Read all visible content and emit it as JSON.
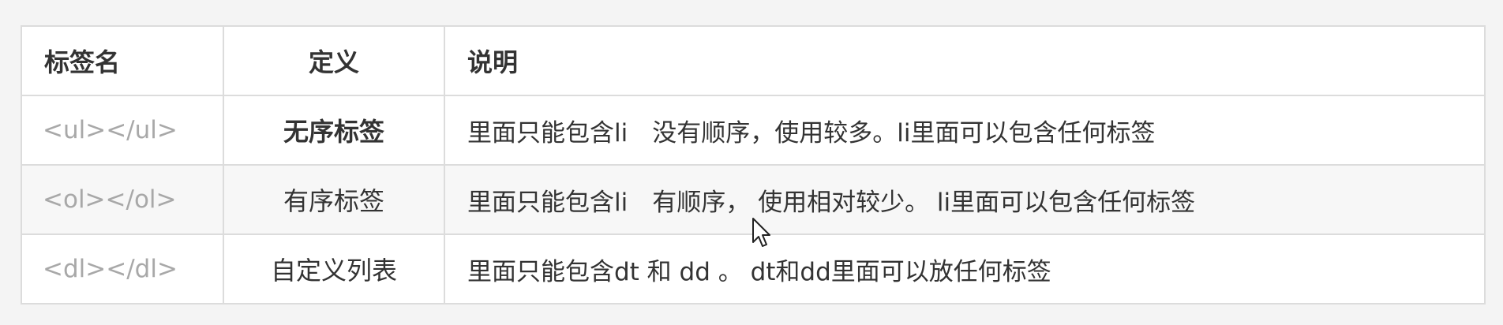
{
  "table": {
    "headers": [
      "标签名",
      "定义",
      "说明"
    ],
    "rows": [
      {
        "tag": "<ul></ul>",
        "definition": "无序标签",
        "description": "里面只能包含li　没有顺序，使用较多。li里面可以包含任何标签"
      },
      {
        "tag": "<ol></ol>",
        "definition": "有序标签",
        "description": "里面只能包含li　有顺序， 使用相对较少。 li里面可以包含任何标签"
      },
      {
        "tag": "<dl></dl>",
        "definition": "自定义列表",
        "description": "里面只能包含dt 和 dd 。 dt和dd里面可以放任何标签"
      }
    ]
  },
  "cursor": {
    "icon": "mouse-pointer-icon"
  }
}
